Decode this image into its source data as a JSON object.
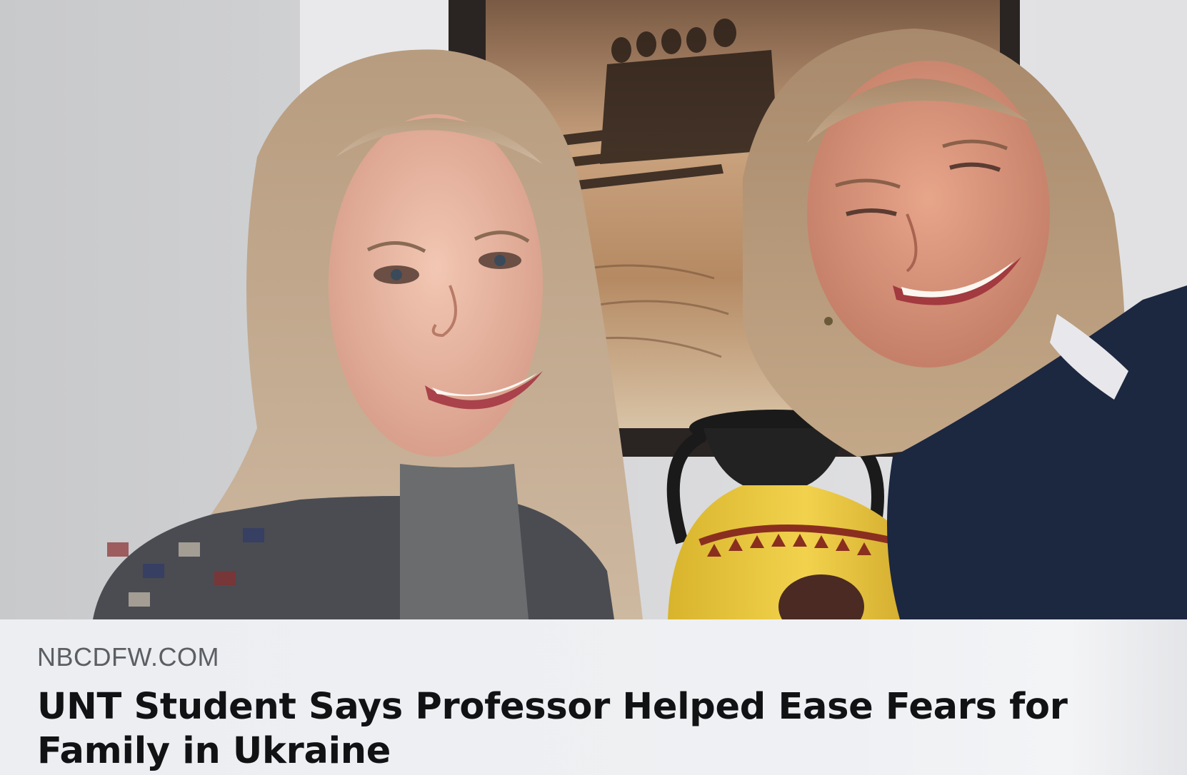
{
  "link_preview": {
    "image_alt": "Two women smiling in a selfie beside a Greek-style vase and a framed rowing poster",
    "domain": "NBCDFW.COM",
    "headline": "UNT Student Says Professor Helped Ease Fears for Family in Ukraine"
  },
  "colors": {
    "meta_background": "#eef0f3",
    "domain_text": "#5b5e63",
    "headline_text": "#111214"
  }
}
